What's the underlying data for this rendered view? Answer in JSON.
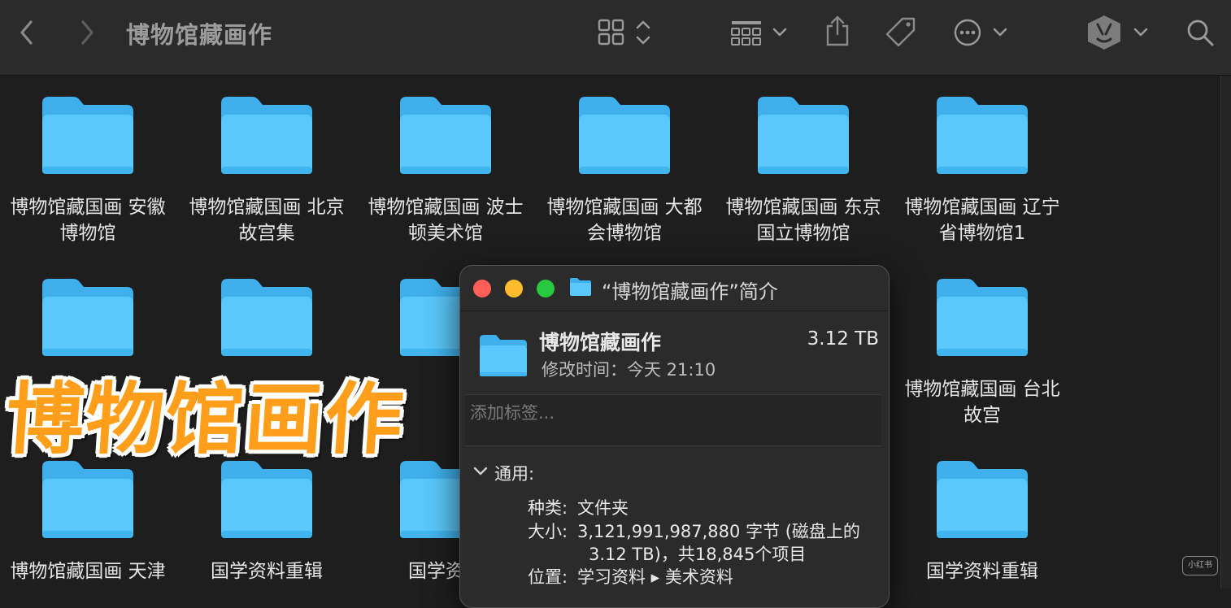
{
  "toolbar": {
    "title": "博物馆藏画作"
  },
  "grid_items": [
    {
      "line1": "博物馆藏国画 安徽",
      "line2": "博物馆"
    },
    {
      "line1": "博物馆藏国画 北京",
      "line2": "故宫集"
    },
    {
      "line1": "博物馆藏国画 波士",
      "line2": "顿美术馆"
    },
    {
      "line1": "博物馆藏国画 大都",
      "line2": "会博物馆"
    },
    {
      "line1": "博物馆藏国画 东京",
      "line2": "国立博物馆"
    },
    {
      "line1": "博物馆藏国画 辽宁",
      "line2": "省博物馆1"
    },
    {
      "line1": "博物馆藏国画 台北",
      "line2": "故宫"
    },
    {
      "line1": "博物馆藏国画 天津",
      "line2": ""
    },
    {
      "line1": "国学资料重辑",
      "line2": ""
    },
    {
      "line1": "国学资料",
      "line2": ""
    },
    {
      "line1": "国学资料重辑",
      "line2": ""
    }
  ],
  "overlay_text": "博物馆画作",
  "info_window": {
    "title": "“博物馆藏画作”简介",
    "name": "博物馆藏画作",
    "size": "3.12 TB",
    "modified": "修改时间：今天 21:10",
    "tag_placeholder": "添加标签...",
    "section": "通用:",
    "kind_label": "种类:",
    "kind_value": "文件夹",
    "size_label": "大小:",
    "size_value_line1": "3,121,991,987,880 字节 (磁盘上的",
    "size_value_line2": "3.12 TB)，共18,845个项目",
    "where_label": "位置:",
    "where_value": "学习资料 ▸ 美术资料"
  },
  "watermark": "小红书",
  "colors": {
    "folder_body": "#5ac8fa",
    "folder_tab": "#3fb0ec",
    "close": "#ff5f57",
    "minimize": "#febc2e",
    "zoom": "#28c840",
    "overlay_fill": "#ff9e1a"
  },
  "icons": [
    "chevron-left-icon",
    "chevron-right-icon",
    "grid-view-icon",
    "sort-icon",
    "group-icon",
    "share-icon",
    "tag-icon",
    "more-icon",
    "profile-icon",
    "search-icon"
  ]
}
